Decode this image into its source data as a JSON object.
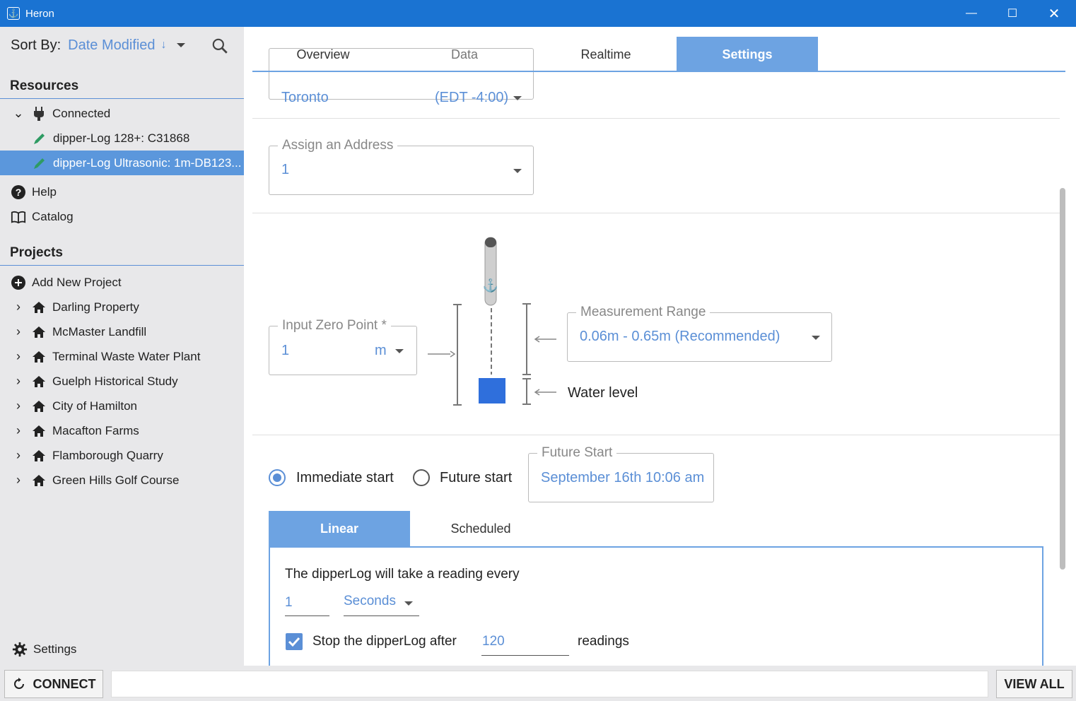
{
  "window": {
    "title": "Heron"
  },
  "sidebar": {
    "sort_label": "Sort By:",
    "sort_value": "Date Modified",
    "sort_direction": "↓",
    "resources_heading": "Resources",
    "connected_label": "Connected",
    "devices": [
      {
        "label": "dipper-Log 128+: C31868"
      },
      {
        "label": "dipper-Log Ultrasonic: 1m-DB123..."
      }
    ],
    "help_label": "Help",
    "catalog_label": "Catalog",
    "projects_heading": "Projects",
    "add_project_label": "Add New Project",
    "projects": [
      {
        "label": "Darling Property"
      },
      {
        "label": "McMaster Landfill"
      },
      {
        "label": "Terminal Waste Water Plant"
      },
      {
        "label": "Guelph Historical Study"
      },
      {
        "label": "City of Hamilton"
      },
      {
        "label": "Macafton Farms"
      },
      {
        "label": "Flamborough Quarry"
      },
      {
        "label": "Green Hills Golf Course"
      }
    ],
    "settings_label": "Settings"
  },
  "tabs": [
    {
      "label": "Overview"
    },
    {
      "label": "Data"
    },
    {
      "label": "Realtime"
    },
    {
      "label": "Settings"
    }
  ],
  "timezone": {
    "city": "Toronto",
    "offset": "(EDT -4:00)"
  },
  "address": {
    "label": "Assign an Address",
    "value": "1"
  },
  "zero_point": {
    "label": "Input Zero Point *",
    "value": "1",
    "unit": "m"
  },
  "measurement_range": {
    "label": "Measurement Range",
    "value": "0.06m - 0.65m (Recommended)"
  },
  "water_level_label": "Water level",
  "start": {
    "immediate_label": "Immediate start",
    "future_label": "Future start",
    "future_field_label": "Future Start",
    "future_field_value": "September 16th 10:06 am"
  },
  "mode_tabs": {
    "linear": "Linear",
    "scheduled": "Scheduled"
  },
  "linear": {
    "intro": "The dipperLog will take a reading every",
    "interval_value": "1",
    "interval_unit": "Seconds",
    "stop_label": "Stop the dipperLog after",
    "stop_value": "120",
    "stop_suffix": "readings"
  },
  "bottom": {
    "connect_label": "CONNECT",
    "view_all_label": "VIEW ALL"
  },
  "colors": {
    "titlebar": "#1a73d2",
    "accent": "#5b8fd6",
    "selected_row": "#5b97dc",
    "probe_square": "#2f6fdc"
  }
}
